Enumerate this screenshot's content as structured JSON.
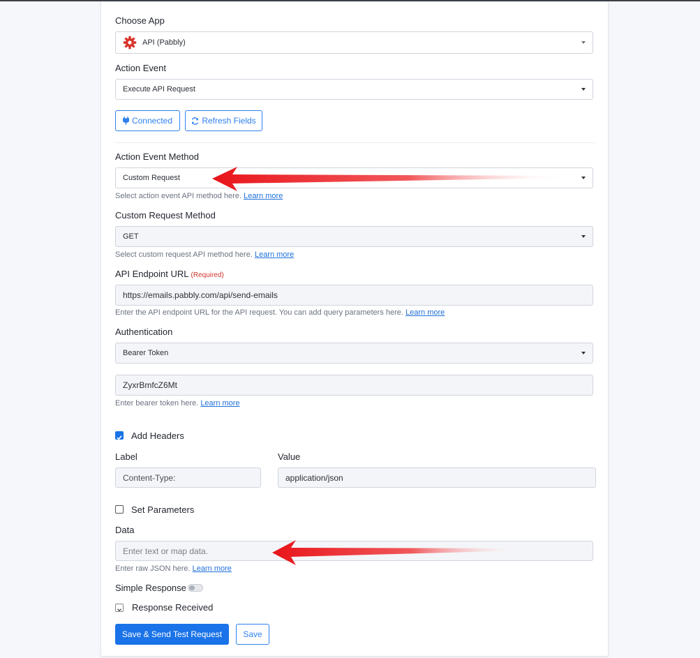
{
  "choose_app": {
    "label": "Choose App",
    "value": "API (Pabbly)"
  },
  "action_event": {
    "label": "Action Event",
    "value": "Execute API Request"
  },
  "buttons": {
    "connected": "Connected",
    "refresh": "Refresh Fields",
    "save_test": "Save & Send Test Request",
    "save": "Save"
  },
  "action_event_method": {
    "label": "Action Event Method",
    "value": "Custom Request",
    "help": "Select action event API method here.",
    "link": "Learn more"
  },
  "custom_request_method": {
    "label": "Custom Request Method",
    "value": "GET",
    "help": "Select custom request API method here.",
    "link": "Learn more"
  },
  "endpoint": {
    "label": "API Endpoint URL",
    "required": "(Required)",
    "value": "https://emails.pabbly.com/api/send-emails",
    "help": "Enter the API endpoint URL for the API request. You can add query parameters here.",
    "link": "Learn more"
  },
  "authentication": {
    "label": "Authentication",
    "value": "Bearer Token"
  },
  "token": {
    "value": "ZyxrBmfcZ6Mt",
    "help": "Enter bearer token here.",
    "link": "Learn more"
  },
  "headers": {
    "checkbox_label": "Add Headers",
    "checked": true,
    "label_col": "Label",
    "value_col": "Value",
    "label_value": "Content-Type:",
    "value_value": "application/json"
  },
  "parameters": {
    "checkbox_label": "Set Parameters",
    "checked": false
  },
  "data": {
    "label": "Data",
    "placeholder": "Enter text or map data.",
    "help": "Enter raw JSON here.",
    "link": "Learn more"
  },
  "simple_response": {
    "label": "Simple Response",
    "enabled": false
  },
  "response_received": {
    "label": "Response Received"
  },
  "colors": {
    "accent": "#1a73e8",
    "arrow": "#e8141a",
    "app_icon": "#d9342b"
  }
}
